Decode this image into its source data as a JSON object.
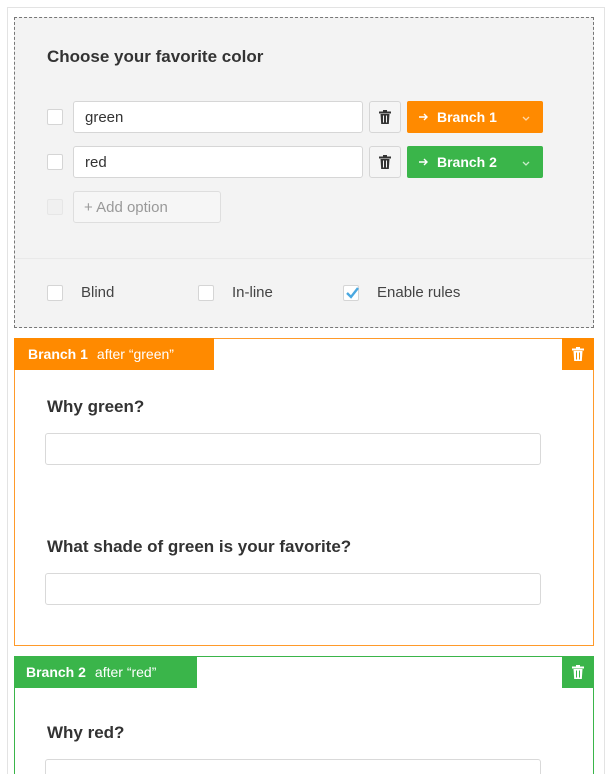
{
  "question": {
    "title": "Choose your favorite color",
    "options": [
      {
        "value": "green",
        "branch_label": "Branch 1",
        "branch_color": "#ff8a00"
      },
      {
        "value": "red",
        "branch_label": "Branch 2",
        "branch_color": "#3ab54a"
      }
    ],
    "add_option_label": "+ Add option",
    "settings": [
      {
        "label": "Blind",
        "checked": false
      },
      {
        "label": "In-line",
        "checked": false
      },
      {
        "label": "Enable rules",
        "checked": true
      }
    ]
  },
  "branches": [
    {
      "name": "Branch 1",
      "after": "after “green”",
      "color": "#ff8a00",
      "questions": [
        "Why green?",
        "What shade of green is your favorite?"
      ]
    },
    {
      "name": "Branch 2",
      "after": "after “red”",
      "color": "#3ab54a",
      "questions": [
        "Why red?"
      ]
    }
  ],
  "icons": {
    "trash": "trash-icon",
    "arrow": "arrow-right-icon",
    "chevron": "chevron-down-icon",
    "check": "check-icon"
  },
  "colors": {
    "orange": "#ff8a00",
    "green": "#3ab54a",
    "check": "#4aa8e0"
  }
}
